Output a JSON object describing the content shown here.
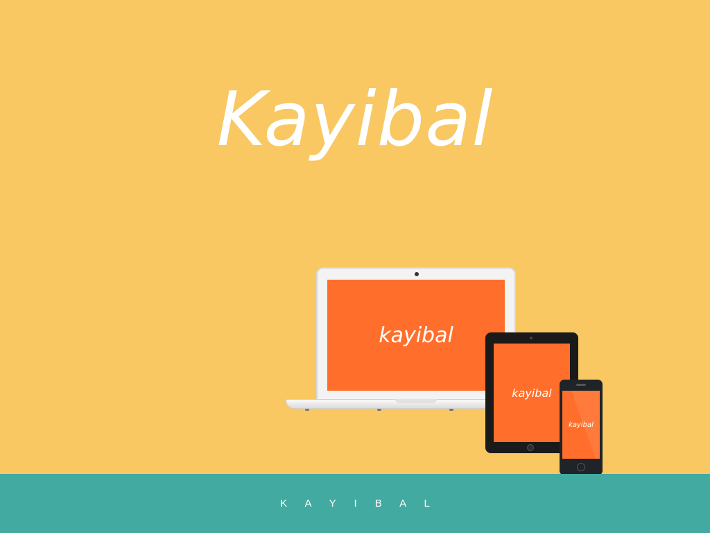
{
  "hero": {
    "title": "Kayibal"
  },
  "devices": {
    "laptop_screen_label": "kayibal",
    "tablet_screen_label": "kayibal",
    "phone_screen_label": "kayibal"
  },
  "footer": {
    "brand": "K A Y I B A L"
  },
  "colors": {
    "background": "#F9C863",
    "screen_orange": "#FF6F2B",
    "footer_teal": "#42AAA0",
    "text": "#FFFFFF"
  }
}
